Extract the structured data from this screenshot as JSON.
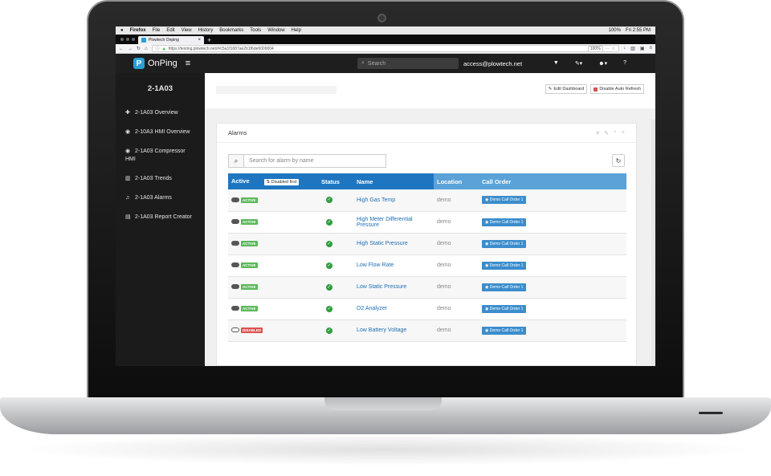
{
  "menubar": {
    "apple": "",
    "app": "Firefox",
    "items": [
      "File",
      "Edit",
      "View",
      "History",
      "Bookmarks",
      "Tools",
      "Window",
      "Help"
    ],
    "status": "100%",
    "clock": "Fri 2:55 PM"
  },
  "browser": {
    "tab_title": "Plowtech Onping",
    "url": "https://testing.plowtech.net/#/c5a1f1687ae2b1f6de6000004",
    "url_host": "plowtech.net",
    "zoom": "100%"
  },
  "header": {
    "brand": "OnPing",
    "search_placeholder": "Search",
    "user": "access@plowtech.net"
  },
  "sidebar": {
    "title": "2-1A03",
    "items": [
      {
        "icon": "✚",
        "label": "2-1A03 Overview",
        "icon_name": "plus-icon"
      },
      {
        "icon": "◉",
        "label": "2-10A3 HMI Overview",
        "icon_name": "eye-icon"
      },
      {
        "icon": "◉",
        "label": "2-1A03 Compressor HMI",
        "icon_name": "eye-icon"
      },
      {
        "icon": "▥",
        "label": "2-1A03 Trends",
        "icon_name": "bar-chart-icon"
      },
      {
        "icon": "♫",
        "label": "2-1A03 Alarms",
        "icon_name": "bell-icon"
      },
      {
        "icon": "▤",
        "label": "2-1A03 Report Creator",
        "icon_name": "book-icon"
      }
    ]
  },
  "actions": {
    "edit": "Edit Dashboard",
    "refresh": "Disable Auto Refresh"
  },
  "panel": {
    "title": "Alarms",
    "search_placeholder": "Search for alarm by name"
  },
  "table": {
    "headers": {
      "active": "Active",
      "disabled_first": "Disabled first",
      "status": "Status",
      "name": "Name",
      "location": "Location",
      "call_order": "Call Order"
    },
    "rows": [
      {
        "state": "ACTIVE",
        "name": "High Gas Temp",
        "location": "demo",
        "call": "Demo Call Order 1"
      },
      {
        "state": "ACTIVE",
        "name": "High Meter Differential Pressure",
        "location": "demo",
        "call": "Demo Call Order 1"
      },
      {
        "state": "ACTIVE",
        "name": "High Static Pressure",
        "location": "demo",
        "call": "Demo Call Order 1"
      },
      {
        "state": "ACTIVE",
        "name": "Low Flow Rate",
        "location": "demo",
        "call": "Demo Call Order 1"
      },
      {
        "state": "ACTIVE",
        "name": "Low Static Pressure",
        "location": "demo",
        "call": "Demo Call Order 1"
      },
      {
        "state": "ACTIVE",
        "name": "O2 Analyzer",
        "location": "demo",
        "call": "Demo Call Order 1"
      },
      {
        "state": "DISABLED",
        "name": "Low Battery Voltage",
        "location": "demo",
        "call": "Demo Call Order 1"
      }
    ]
  },
  "colors": {
    "accent": "#1f76c0",
    "active": "#5cb85c",
    "disabled": "#d9534f",
    "sidebar": "#1b1b1c"
  }
}
